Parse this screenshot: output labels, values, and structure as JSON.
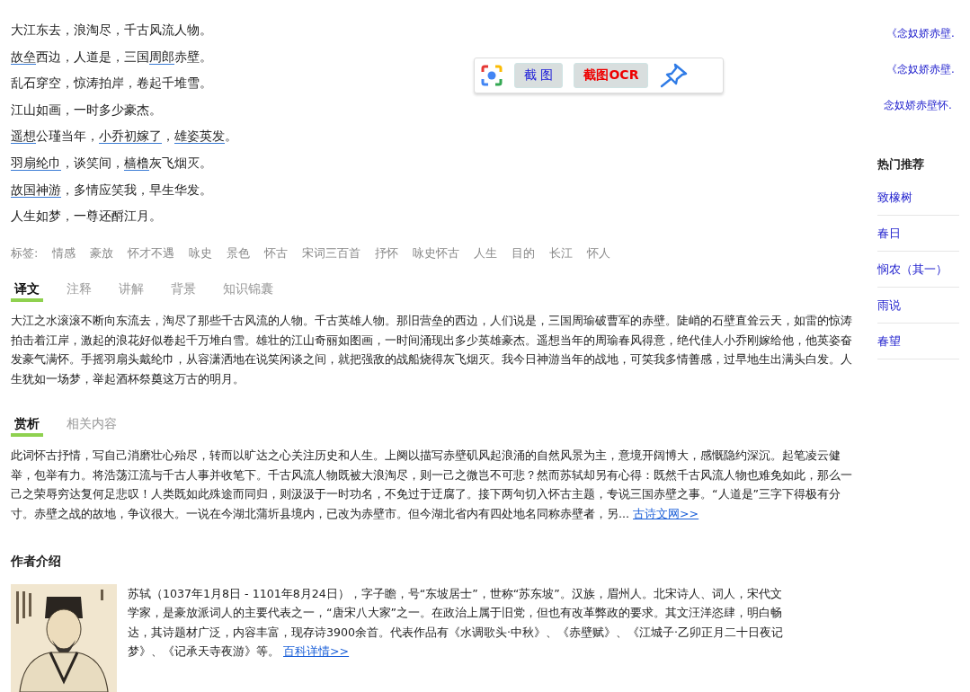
{
  "poem": {
    "lines": [
      [
        {
          "text": "大江东去，浪淘尽，千古风流人物。",
          "annotated": false
        }
      ],
      [
        {
          "text": "故垒",
          "annotated": true
        },
        {
          "text": "西边，人道是，三国",
          "annotated": false
        },
        {
          "text": "周郎",
          "annotated": true
        },
        {
          "text": "赤壁。",
          "annotated": false
        }
      ],
      [
        {
          "text": "乱石穿空，惊涛拍岸，卷起千堆雪。",
          "annotated": false
        }
      ],
      [
        {
          "text": "江山如画，一时多少豪杰。",
          "annotated": false
        }
      ],
      [
        {
          "text": "遥想",
          "annotated": true
        },
        {
          "text": "公瑾当年，",
          "annotated": false
        },
        {
          "text": "小乔初嫁了",
          "annotated": true
        },
        {
          "text": "，",
          "annotated": false
        },
        {
          "text": "雄姿英发",
          "annotated": true
        },
        {
          "text": "。",
          "annotated": false
        }
      ],
      [
        {
          "text": "羽扇纶巾",
          "annotated": true
        },
        {
          "text": "，谈笑间，",
          "annotated": false
        },
        {
          "text": "樯橹",
          "annotated": true
        },
        {
          "text": "灰飞烟灭。",
          "annotated": false
        }
      ],
      [
        {
          "text": "故国神游",
          "annotated": true
        },
        {
          "text": "，多情应笑我，早生华发。",
          "annotated": false
        }
      ],
      [
        {
          "text": "人生如梦，一尊还酹江月。",
          "annotated": false
        }
      ]
    ],
    "tags_label": "标签:",
    "tags": [
      "情感",
      "豪放",
      "怀才不遇",
      "咏史",
      "景色",
      "怀古",
      "宋词三百首",
      "抒怀",
      "咏史怀古",
      "人生",
      "目的",
      "长江",
      "怀人"
    ]
  },
  "translation": {
    "tabs": [
      {
        "label": "译文",
        "selected": true
      },
      {
        "label": "注释",
        "selected": false
      },
      {
        "label": "讲解",
        "selected": false
      },
      {
        "label": "背景",
        "selected": false
      },
      {
        "label": "知识锦囊",
        "selected": false
      }
    ],
    "text": "大江之水滚滚不断向东流去，淘尽了那些千古风流的人物。千古英雄人物。那旧营垒的西边，人们说是，三国周瑜破曹军的赤壁。陡峭的石壁直耸云天，如雷的惊涛拍击着江岸，激起的浪花好似卷起千万堆白雪。雄壮的江山奇丽如图画，一时间涌现出多少英雄豪杰。遥想当年的周瑜春风得意，绝代佳人小乔刚嫁给他，他英姿奋发豪气满怀。手摇羽扇头戴纶巾，从容潇洒地在说笑闲谈之间，就把强敌的战船烧得灰飞烟灭。我今日神游当年的战地，可笑我多情善感，过早地生出满头白发。人生犹如一场梦，举起酒杯祭奠这万古的明月。"
  },
  "appreciation": {
    "tabs": [
      {
        "label": "赏析",
        "selected": true
      },
      {
        "label": "相关内容",
        "selected": false
      }
    ],
    "text": "此词怀古抒情，写自己消磨壮心殆尽，转而以旷达之心关注历史和人生。上阕以描写赤壁矶风起浪涌的自然风景为主，意境开阔博大，感慨隐约深沉。起笔凌云健举，包举有力。将浩荡江流与千古人事并收笔下。千古风流人物既被大浪淘尽，则一己之微岂不可悲？然而苏轼却另有心得：既然千古风流人物也难免如此，那么一己之荣辱穷达复何足悲叹！人类既如此殊途而同归，则汲汲于一时功名，不免过于迂腐了。接下两句切入怀古主题，专说三国赤壁之事。“人道是”三字下得极有分寸。赤壁之战的故地，争议很大。一说在今湖北蒲圻县境内，已改为赤壁市。但今湖北省内有四处地名同称赤壁者，另...",
    "link": "古诗文网>>"
  },
  "author": {
    "heading": "作者介绍",
    "text": "苏轼（1037年1月8日 - 1101年8月24日），字子瞻，号“东坡居士”，世称“苏东坡”。汉族，眉州人。北宋诗人、词人，宋代文学家，是豪放派词人的主要代表之一，“唐宋八大家”之一。在政治上属于旧党，但也有改革弊政的要求。其文汪洋恣肆，明白畅达，其诗题材广泛，内容丰富，现存诗3900余首。代表作品有《水调歌头·中秋》、《赤壁赋》、《江城子·乙卯正月二十日夜记梦》、《记承天寺夜游》等。",
    "link": "百科详情>>"
  },
  "sidebar": {
    "related": [
      "《念奴娇赤壁.",
      "《念奴娇赤壁.",
      "念奴娇赤壁怀."
    ],
    "heading": "热门推荐",
    "items": [
      "致橡树",
      "春日",
      "悯农（其一）",
      "雨说",
      "春望"
    ]
  },
  "screenshot_toolbar": {
    "buttons": [
      {
        "kind": "capture",
        "label": "截 图"
      },
      {
        "kind": "ocr",
        "label": "截图OCR"
      }
    ]
  }
}
